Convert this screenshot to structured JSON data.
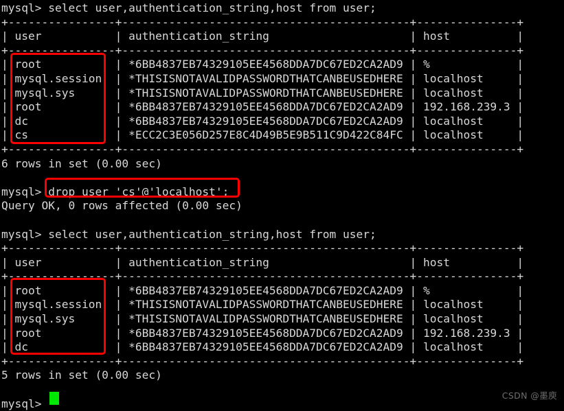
{
  "terminal": {
    "prompt": "mysql> ",
    "colors": {
      "background": "#000000",
      "text": "#d8d8d8",
      "cursor": "#00e800",
      "annotation": "#fe0000",
      "watermark": "#6e6e6e"
    },
    "lines": [
      "mysql> select user,authentication_string,host from user;",
      "+----------------+-------------------------------------------+---------------+",
      "| user           | authentication_string                     | host          |",
      "+----------------+-------------------------------------------+---------------+",
      "| root           | *6BB4837EB74329105EE4568DDA7DC67ED2CA2AD9 | %             |",
      "| mysql.session  | *THISISNOTAVALIDPASSWORDTHATCANBEUSEDHERE | localhost     |",
      "| mysql.sys      | *THISISNOTAVALIDPASSWORDTHATCANBEUSEDHERE | localhost     |",
      "| root           | *6BB4837EB74329105EE4568DDA7DC67ED2CA2AD9 | 192.168.239.3 |",
      "| dc             | *6BB4837EB74329105EE4568DDA7DC67ED2CA2AD9 | localhost     |",
      "| cs             | *ECC2C3E056D257E8C4D49B5E9B511C9D422C84FC | localhost     |",
      "+----------------+-------------------------------------------+---------------+",
      "6 rows in set (0.00 sec)",
      "",
      "mysql> drop user 'cs'@'localhost';",
      "Query OK, 0 rows affected (0.00 sec)",
      "",
      "mysql> select user,authentication_string,host from user;",
      "+----------------+-------------------------------------------+---------------+",
      "| user           | authentication_string                     | host          |",
      "+----------------+-------------------------------------------+---------------+",
      "| root           | *6BB4837EB74329105EE4568DDA7DC67ED2CA2AD9 | %             |",
      "| mysql.session  | *THISISNOTAVALIDPASSWORDTHATCANBEUSEDHERE | localhost     |",
      "| mysql.sys      | *THISISNOTAVALIDPASSWORDTHATCANBEUSEDHERE | localhost     |",
      "| root           | *6BB4837EB74329105EE4568DDA7DC67ED2CA2AD9 | 192.168.239.3 |",
      "| dc             | *6BB4837EB74329105EE4568DDA7DC67ED2CA2AD9 | localhost     |",
      "+----------------+-------------------------------------------+---------------+",
      "5 rows in set (0.00 sec)",
      "",
      "mysql> "
    ],
    "commands": [
      "select user,authentication_string,host from user;",
      "drop user 'cs'@'localhost';",
      "select user,authentication_string,host from user;"
    ],
    "result_first": {
      "columns": [
        "user",
        "authentication_string",
        "host"
      ],
      "rows": [
        [
          "root",
          "*6BB4837EB74329105EE4568DDA7DC67ED2CA2AD9",
          "%"
        ],
        [
          "mysql.session",
          "*THISISNOTAVALIDPASSWORDTHATCANBEUSEDHERE",
          "localhost"
        ],
        [
          "mysql.sys",
          "*THISISNOTAVALIDPASSWORDTHATCANBEUSEDHERE",
          "localhost"
        ],
        [
          "root",
          "*6BB4837EB74329105EE4568DDA7DC67ED2CA2AD9",
          "192.168.239.3"
        ],
        [
          "dc",
          "*6BB4837EB74329105EE4568DDA7DC67ED2CA2AD9",
          "localhost"
        ],
        [
          "cs",
          "*ECC2C3E056D257E8C4D49B5E9B511C9D422C84FC",
          "localhost"
        ]
      ],
      "status": "6 rows in set (0.00 sec)"
    },
    "drop_result": "Query OK, 0 rows affected (0.00 sec)",
    "result_second": {
      "columns": [
        "user",
        "authentication_string",
        "host"
      ],
      "rows": [
        [
          "root",
          "*6BB4837EB74329105EE4568DDA7DC67ED2CA2AD9",
          "%"
        ],
        [
          "mysql.session",
          "*THISISNOTAVALIDPASSWORDTHATCANBEUSEDHERE",
          "localhost"
        ],
        [
          "mysql.sys",
          "*THISISNOTAVALIDPASSWORDTHATCANBEUSEDHERE",
          "localhost"
        ],
        [
          "root",
          "*6BB4837EB74329105EE4568DDA7DC67ED2CA2AD9",
          "192.168.239.3"
        ],
        [
          "dc",
          "*6BB4837EB74329105EE4568DDA7DC67ED2CA2AD9",
          "localhost"
        ]
      ],
      "status": "5 rows in set (0.00 sec)"
    }
  },
  "watermark": {
    "text": "CSDN @墨庾"
  }
}
